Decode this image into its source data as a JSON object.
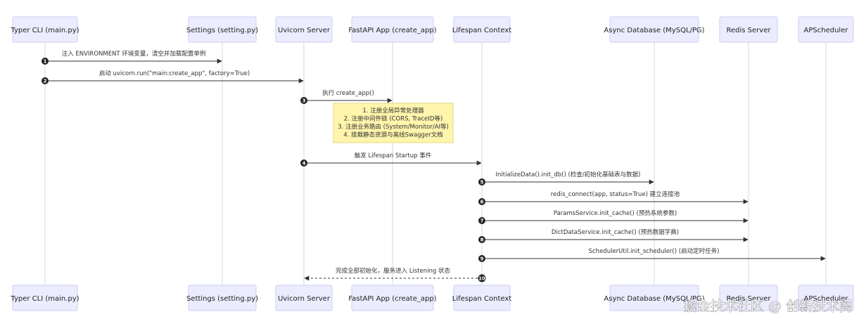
{
  "participants": [
    {
      "id": "cli",
      "label": "Typer CLI (main.py)"
    },
    {
      "id": "settings",
      "label": "Settings (setting.py)"
    },
    {
      "id": "uvicorn",
      "label": "Uvicorn Server"
    },
    {
      "id": "fastapi",
      "label": "FastAPI App (create_app)"
    },
    {
      "id": "lifespan",
      "label": "Lifespan Context"
    },
    {
      "id": "db",
      "label": "Async Database (MySQL/PG)"
    },
    {
      "id": "redis",
      "label": "Redis Server"
    },
    {
      "id": "scheduler",
      "label": "APScheduler"
    }
  ],
  "messages": [
    {
      "num": "1",
      "from": "cli",
      "to": "settings",
      "text": "注入 ENVIRONMENT 环境变量，清空并加载配置单例",
      "style": "solid"
    },
    {
      "num": "2",
      "from": "cli",
      "to": "uvicorn",
      "text": "启动 uvicorn.run(\"main:create_app\", factory=True)",
      "style": "solid"
    },
    {
      "num": "3",
      "from": "uvicorn",
      "to": "fastapi",
      "text": "执行 create_app()",
      "style": "solid"
    },
    {
      "num": "4",
      "from": "uvicorn",
      "to": "lifespan",
      "text": "触发 Lifespan Startup 事件",
      "style": "solid"
    },
    {
      "num": "5",
      "from": "lifespan",
      "to": "db",
      "text": "InitializeData().init_db() (检查/初始化基础表与数据)",
      "style": "solid"
    },
    {
      "num": "6",
      "from": "lifespan",
      "to": "redis",
      "text": "redis_connect(app, status=True) 建立连接池",
      "style": "solid"
    },
    {
      "num": "7",
      "from": "lifespan",
      "to": "redis",
      "text": "ParamsService.init_cache() (预热系统参数)",
      "style": "solid"
    },
    {
      "num": "8",
      "from": "lifespan",
      "to": "redis",
      "text": "DictDataService.init_cache() (预热数据字典)",
      "style": "solid"
    },
    {
      "num": "9",
      "from": "lifespan",
      "to": "scheduler",
      "text": "SchedulerUtil.init_scheduler() (启动定时任务)",
      "style": "solid"
    },
    {
      "num": "10",
      "from": "lifespan",
      "to": "uvicorn",
      "text": "完成全部初始化，服务进入 Listening 状态",
      "style": "dashed"
    }
  ],
  "note": {
    "lines": [
      "1. 注册全局异常处理器",
      "2. 注册中间件链 (CORS, TraceID等)",
      "3. 注册业务路由 (System/Monitor/AI等)",
      "4. 挂载静态资源与离线Swagger文档"
    ]
  },
  "watermark": "掘金技术社区 @ 创新技术阁",
  "colors": {
    "actor_fill": "#ECECFF",
    "actor_stroke": "#CCCCF5",
    "note_fill": "#FFF5AD",
    "line": "#333333"
  }
}
